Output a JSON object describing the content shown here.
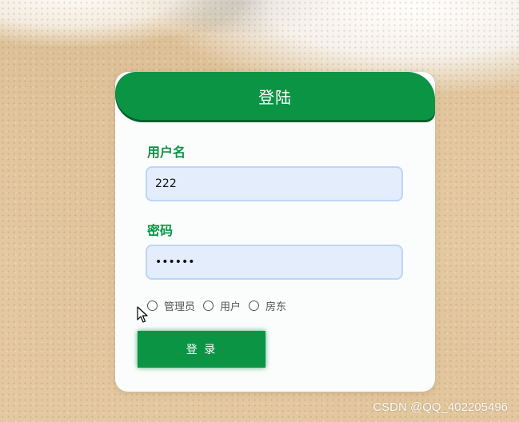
{
  "login": {
    "title": "登陆",
    "username_label": "用户名",
    "username_value": "222",
    "password_label": "密码",
    "password_value": "123456",
    "roles": [
      "管理员",
      "用户",
      "房东"
    ],
    "submit_label": "登 录"
  },
  "watermark": "CSDN @QQ_402205496",
  "colors": {
    "primary_green": "#0a9444",
    "input_bg": "#e3edfc",
    "input_border": "#bcd6fb"
  }
}
